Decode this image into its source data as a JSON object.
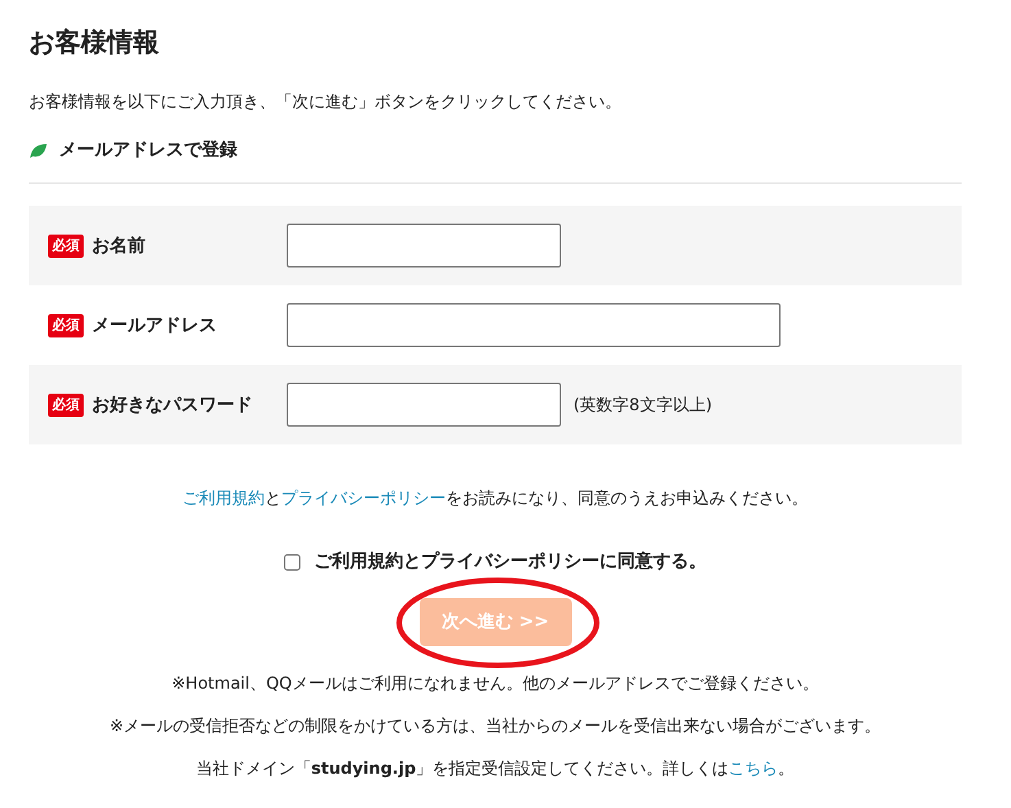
{
  "heading": "お客様情報",
  "intro": "お客様情報を以下にご入力頂き、「次に進む」ボタンをクリックしてください。",
  "section": {
    "title": "メールアドレスで登録"
  },
  "fields": [
    {
      "badge": "必須",
      "label": "お名前",
      "kind": "text"
    },
    {
      "badge": "必須",
      "label": "メールアドレス",
      "kind": "email"
    },
    {
      "badge": "必須",
      "label": "お好きなパスワード",
      "kind": "password",
      "note": "(英数字8文字以上)"
    }
  ],
  "terms": [
    {
      "text": "ご利用規約",
      "link": true
    },
    {
      "text": "と",
      "link": false
    },
    {
      "text": "プライバシーポリシー",
      "link": true
    },
    {
      "text": "をお読みになり、同意のうえお申込みください。",
      "link": false
    }
  ],
  "agree": {
    "label": "ご利用規約とプライバシーポリシーに同意する。",
    "checked": false
  },
  "next_button": {
    "label": "次へ進む >>",
    "disabled": true,
    "highlighted": true
  },
  "notes": [
    [
      {
        "text": "※Hotmail、QQメールはご利用になれません。他のメールアドレスでご登録ください。",
        "link": false
      }
    ],
    [
      {
        "text": "※メールの受信拒否などの制限をかけている方は、当社からのメールを受信出来ない場合がございます。",
        "link": false
      }
    ],
    [
      {
        "text": "当社ドメイン「**studying.jp**」を指定受信設定してください。詳しくは",
        "link": false
      },
      {
        "text": "こちら",
        "link": true
      },
      {
        "text": "。",
        "link": false
      }
    ]
  ]
}
